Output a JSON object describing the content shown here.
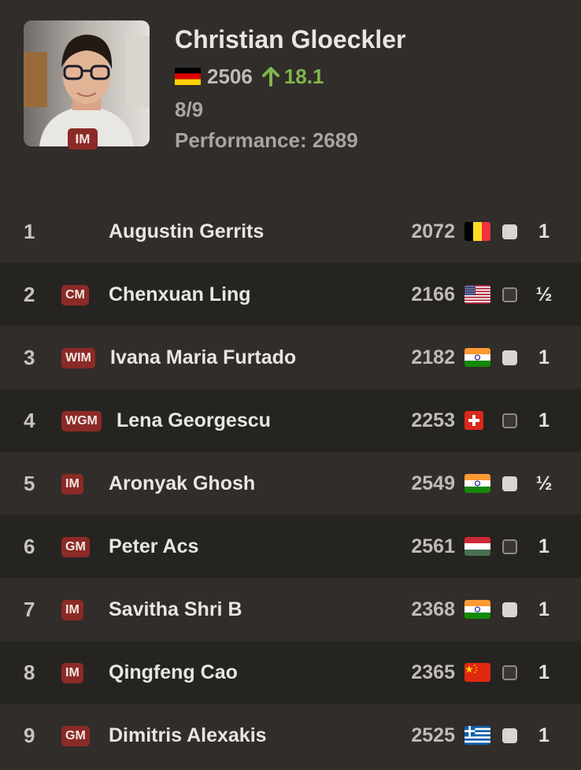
{
  "player": {
    "name": "Christian Gloeckler",
    "title": "IM",
    "country_flag": "germany-flag",
    "rating": "2506",
    "rating_change": "18.1",
    "score": "8/9",
    "performance": "Performance: 2689"
  },
  "colors": {
    "background": "#302d2a",
    "alt_row": "#262421",
    "title_badge": "#8b2a26",
    "positive_change": "#81b64c"
  },
  "games": [
    {
      "round": "1",
      "title": "",
      "name": "Augustin Gerrits",
      "rating": "2072",
      "flag": "belgium-flag",
      "color": "white",
      "result": "1"
    },
    {
      "round": "2",
      "title": "CM",
      "name": "Chenxuan Ling",
      "rating": "2166",
      "flag": "usa-flag",
      "color": "black",
      "result": "½"
    },
    {
      "round": "3",
      "title": "WIM",
      "name": "Ivana Maria Furtado",
      "rating": "2182",
      "flag": "india-flag",
      "color": "white",
      "result": "1"
    },
    {
      "round": "4",
      "title": "WGM",
      "name": "Lena Georgescu",
      "rating": "2253",
      "flag": "switzerland-flag",
      "color": "black",
      "result": "1"
    },
    {
      "round": "5",
      "title": "IM",
      "name": "Aronyak Ghosh",
      "rating": "2549",
      "flag": "india-flag",
      "color": "white",
      "result": "½"
    },
    {
      "round": "6",
      "title": "GM",
      "name": "Peter Acs",
      "rating": "2561",
      "flag": "hungary-flag",
      "color": "black",
      "result": "1"
    },
    {
      "round": "7",
      "title": "IM",
      "name": "Savitha Shri B",
      "rating": "2368",
      "flag": "india-flag",
      "color": "white",
      "result": "1"
    },
    {
      "round": "8",
      "title": "IM",
      "name": "Qingfeng Cao",
      "rating": "2365",
      "flag": "china-flag",
      "color": "black",
      "result": "1"
    },
    {
      "round": "9",
      "title": "GM",
      "name": "Dimitris Alexakis",
      "rating": "2525",
      "flag": "greece-flag",
      "color": "white",
      "result": "1"
    }
  ]
}
